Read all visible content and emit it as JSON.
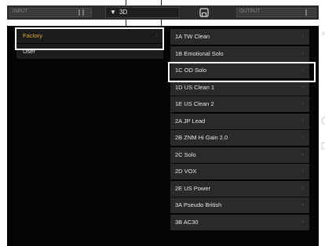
{
  "topbar": {
    "input_label": "INPUT",
    "output_label": "OUTPUT",
    "preset_value": "3D",
    "preset_arrow": "▼",
    "save_icon": "save-icon"
  },
  "sidebar": {
    "items": [
      {
        "label": "Factory",
        "selected": true
      },
      {
        "label": "User",
        "selected": false
      }
    ]
  },
  "presets": {
    "items": [
      {
        "label": "1A TW Clean"
      },
      {
        "label": "1B Emotional Solo"
      },
      {
        "label": "1C OD Solo"
      },
      {
        "label": "1D US Clean 1"
      },
      {
        "label": "1E US Clean 2"
      },
      {
        "label": "2A JP Lead"
      },
      {
        "label": "2B ZNM Hi Gain 2.0"
      },
      {
        "label": "2C Solo"
      },
      {
        "label": "2D VOX"
      },
      {
        "label": "2E US Power"
      },
      {
        "label": "3A Pseudo British"
      },
      {
        "label": "3B AC30"
      }
    ]
  },
  "chevron": "›",
  "close_glyph": "×"
}
